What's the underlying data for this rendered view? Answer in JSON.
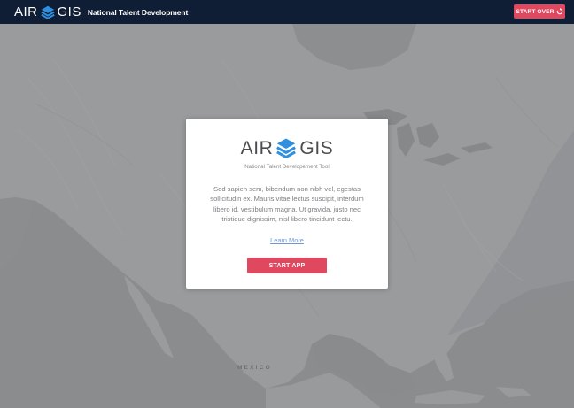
{
  "header": {
    "brand_left": "AIR",
    "brand_right": "GIS",
    "subtitle": "National Talent Development",
    "start_over_label": "START OVER",
    "start_over_icon": "refresh-icon"
  },
  "map": {
    "label": "MEXICO"
  },
  "modal": {
    "brand_left": "AIR",
    "brand_right": "GIS",
    "tagline": "National Talent Developement Tool",
    "description": "Sed sapien sem, bibendum non nibh vel, egestas sollicitudin ex. Mauris vitae lectus suscipit, interdum libero id, vestibulum magna. Ut gravida, justo nec tristique dignissim, nisl libero tincidunt lectu.",
    "learn_more_label": "Learn More",
    "start_app_label": "START APP"
  },
  "colors": {
    "header_bg": "#0f1e34",
    "accent_red": "#e0485f",
    "logo_blue": "#2f8fe0",
    "link_blue": "#6e97d8",
    "map_land": "#9a9b9d",
    "map_water": "#8b8c8e"
  }
}
